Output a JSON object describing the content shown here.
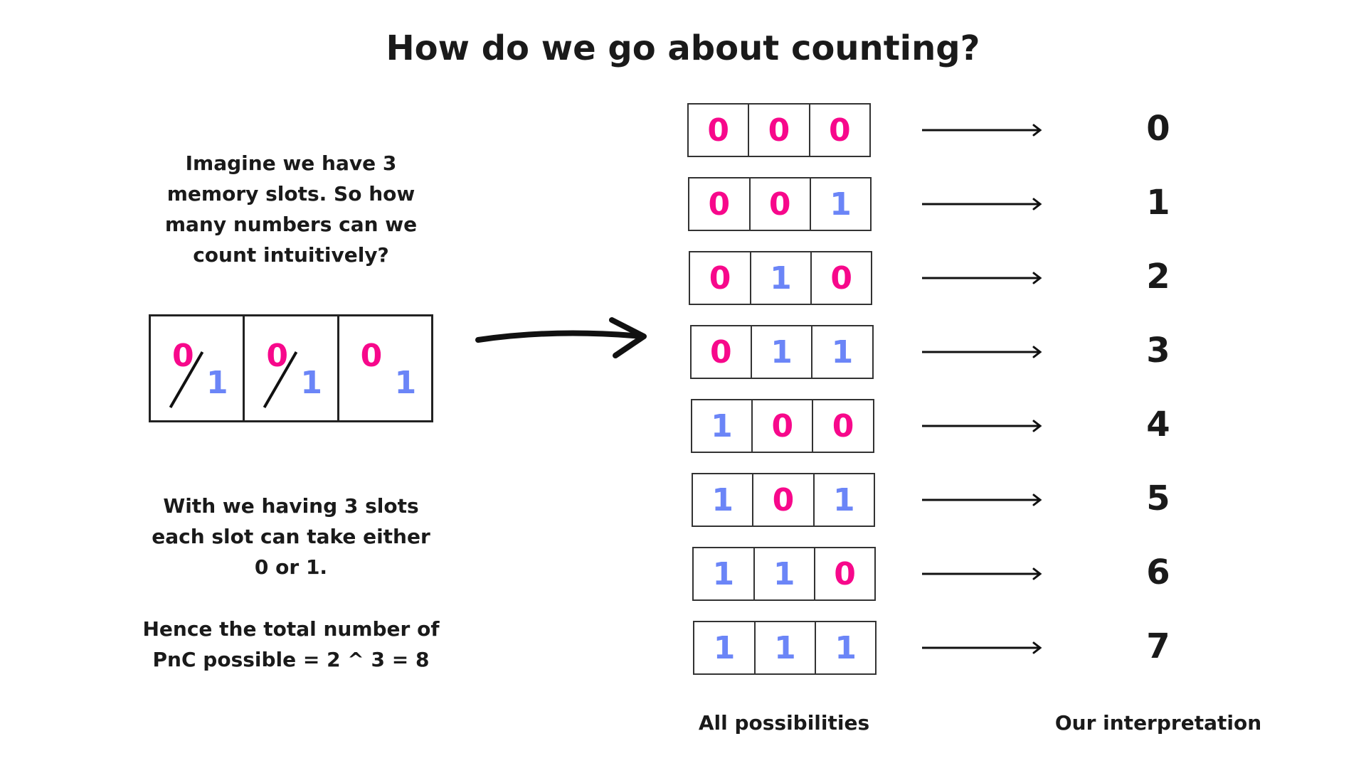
{
  "title": "How do we go about counting?",
  "intro_lines": [
    "Imagine we have 3",
    "memory slots. So how",
    "many numbers can we",
    "count intuitively?"
  ],
  "explain_lines": [
    "With we having 3 slots",
    "each slot can take either",
    "0 or 1."
  ],
  "total_lines": [
    "Hence the total number of",
    "PnC possible = 2 ^ 3 = 8"
  ],
  "slots": [
    {
      "zero": "0",
      "one": "1",
      "slash": true
    },
    {
      "zero": "0",
      "one": "1",
      "slash": true
    },
    {
      "zero": "0",
      "one": "1",
      "slash": false
    }
  ],
  "rows": [
    {
      "bits": [
        "0",
        "0",
        "0"
      ],
      "value": "0"
    },
    {
      "bits": [
        "0",
        "0",
        "1"
      ],
      "value": "1"
    },
    {
      "bits": [
        "0",
        "1",
        "0"
      ],
      "value": "2"
    },
    {
      "bits": [
        "0",
        "1",
        "1"
      ],
      "value": "3"
    },
    {
      "bits": [
        "1",
        "0",
        "0"
      ],
      "value": "4"
    },
    {
      "bits": [
        "1",
        "0",
        "1"
      ],
      "value": "5"
    },
    {
      "bits": [
        "1",
        "1",
        "0"
      ],
      "value": "6"
    },
    {
      "bits": [
        "1",
        "1",
        "1"
      ],
      "value": "7"
    }
  ],
  "labels": {
    "possibilities": "All possibilities",
    "interpretation": "Our interpretation"
  },
  "colors": {
    "zero": "#f7088b",
    "one": "#6b85f7"
  }
}
